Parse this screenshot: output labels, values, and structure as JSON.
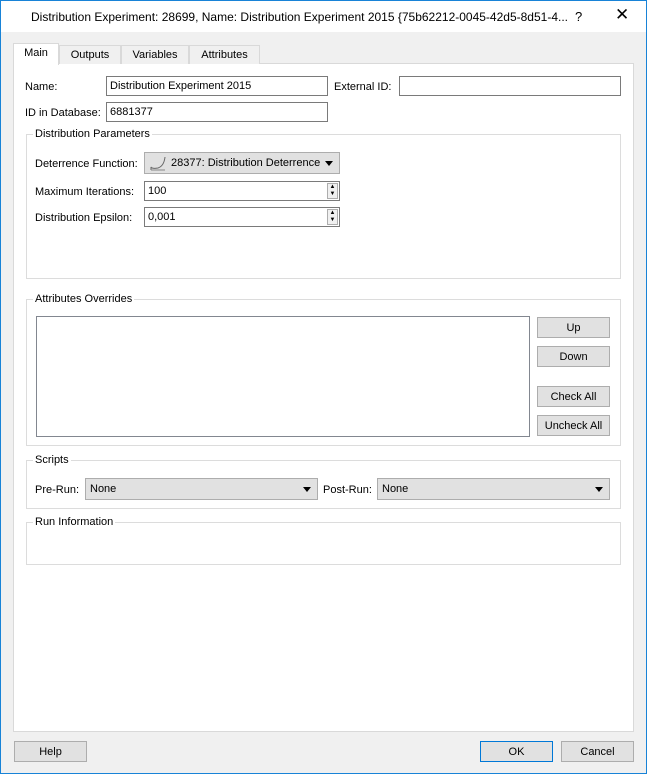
{
  "window": {
    "title": "Distribution Experiment: 28699, Name: Distribution Experiment 2015  {75b62212-0045-42d5-8d51-4...",
    "help_glyph": "?",
    "close_glyph": "✕"
  },
  "tabs": [
    {
      "label": "Main"
    },
    {
      "label": "Outputs"
    },
    {
      "label": "Variables"
    },
    {
      "label": "Attributes"
    }
  ],
  "fields": {
    "name_label": "Name:",
    "name_value": "Distribution Experiment 2015",
    "external_id_label": "External ID:",
    "external_id_value": "",
    "id_label": "ID in Database:",
    "id_value": "6881377"
  },
  "distribution": {
    "title": "Distribution Parameters",
    "deterrence_label": "Deterrence Function:",
    "deterrence_value": "28377: Distribution Deterrence",
    "iterations_label": "Maximum Iterations:",
    "iterations_value": "100",
    "epsilon_label": "Distribution Epsilon:",
    "epsilon_value": "0,001"
  },
  "overrides": {
    "title": "Attributes Overrides",
    "up": "Up",
    "down": "Down",
    "check_all": "Check All",
    "uncheck_all": "Uncheck All"
  },
  "scripts": {
    "title": "Scripts",
    "pre_label": "Pre-Run:",
    "pre_value": "None",
    "post_label": "Post-Run:",
    "post_value": "None"
  },
  "run_info": {
    "title": "Run Information"
  },
  "footer": {
    "help": "Help",
    "ok": "OK",
    "cancel": "Cancel"
  }
}
